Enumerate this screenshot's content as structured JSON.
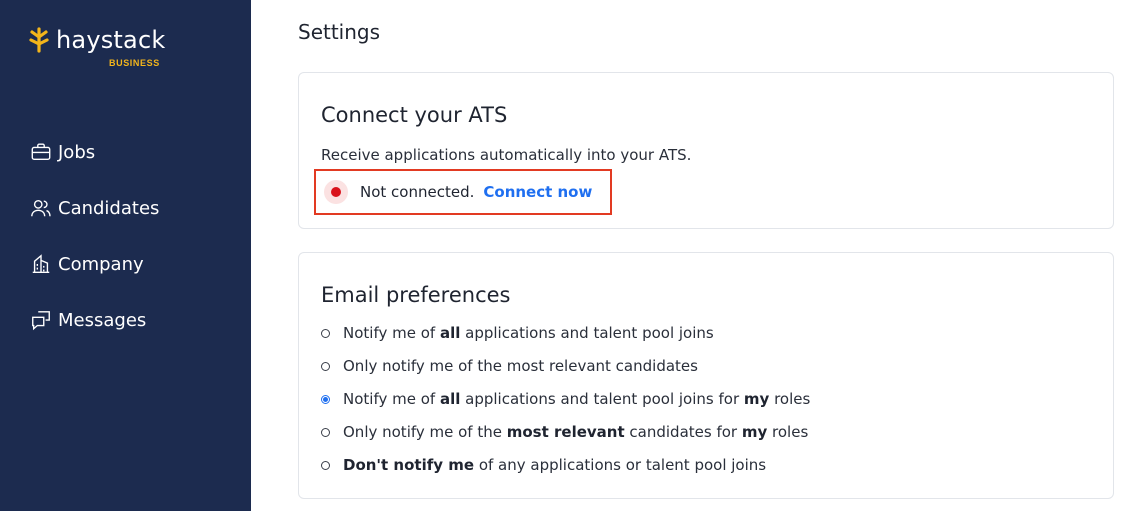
{
  "brand": {
    "name": "haystack",
    "tagline": "BUSINESS",
    "accent_color": "#f3b51b",
    "sidebar_color": "#1c2b4f"
  },
  "nav": {
    "items": [
      {
        "label": "Jobs",
        "icon": "briefcase-icon"
      },
      {
        "label": "Candidates",
        "icon": "people-icon"
      },
      {
        "label": "Company",
        "icon": "building-icon"
      },
      {
        "label": "Messages",
        "icon": "chat-icon"
      }
    ]
  },
  "page": {
    "title": "Settings"
  },
  "ats": {
    "title": "Connect your ATS",
    "description": "Receive applications automatically into your ATS.",
    "status_text": "Not connected.",
    "connect_label": "Connect now",
    "status_color": "#d9121b",
    "link_color": "#1f6ff0"
  },
  "email": {
    "title": "Email preferences",
    "selected_index": 2,
    "options": [
      [
        {
          "t": "Notify me of ",
          "b": false
        },
        {
          "t": "all",
          "b": true
        },
        {
          "t": " applications and talent pool joins",
          "b": false
        }
      ],
      [
        {
          "t": "Only notify me of the most relevant candidates",
          "b": false
        }
      ],
      [
        {
          "t": "Notify me of ",
          "b": false
        },
        {
          "t": "all",
          "b": true
        },
        {
          "t": " applications and talent pool joins for ",
          "b": false
        },
        {
          "t": "my",
          "b": true
        },
        {
          "t": " roles",
          "b": false
        }
      ],
      [
        {
          "t": "Only notify me of the ",
          "b": false
        },
        {
          "t": "most relevant",
          "b": true
        },
        {
          "t": " candidates for ",
          "b": false
        },
        {
          "t": "my",
          "b": true
        },
        {
          "t": " roles",
          "b": false
        }
      ],
      [
        {
          "t": "Don't notify me",
          "b": true
        },
        {
          "t": " of any applications or talent pool joins",
          "b": false
        }
      ]
    ]
  }
}
